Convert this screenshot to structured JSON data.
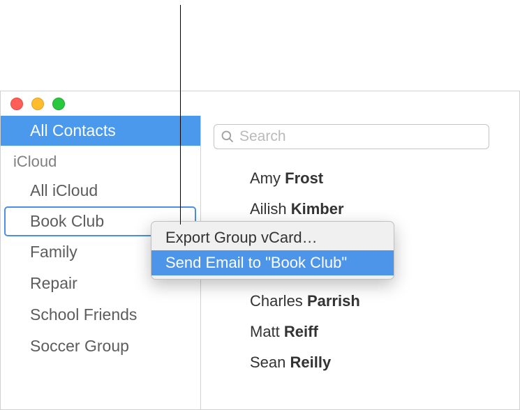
{
  "window": {
    "search_placeholder": "Search"
  },
  "sidebar": {
    "selected": "All Contacts",
    "section_label": "iCloud",
    "items": [
      {
        "label": "All iCloud"
      },
      {
        "label": "Book Club"
      },
      {
        "label": "Family"
      },
      {
        "label": "Repair"
      },
      {
        "label": "School Friends"
      },
      {
        "label": "Soccer Group"
      }
    ]
  },
  "contacts": [
    {
      "first": "Amy",
      "last": "Frost"
    },
    {
      "first": "Ailish",
      "last": "Kimber"
    },
    {
      "first": "Charles",
      "last": "Parrish"
    },
    {
      "first": "Matt",
      "last": "Reiff"
    },
    {
      "first": "Sean",
      "last": "Reilly"
    }
  ],
  "context_menu": {
    "items": [
      {
        "label": "Export Group vCard…"
      },
      {
        "label": "Send Email to \"Book Club\""
      }
    ]
  }
}
